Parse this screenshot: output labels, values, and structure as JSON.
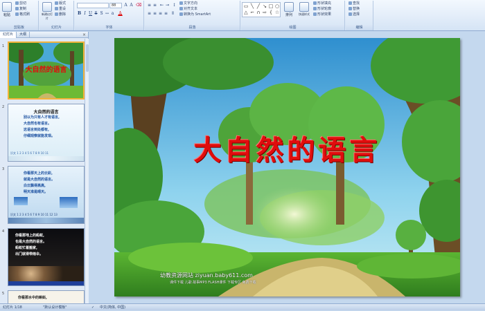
{
  "ribbon": {
    "clipboard": {
      "paste": "粘贴",
      "cut": "剪切",
      "copy": "复制",
      "format_painter": "格式刷",
      "label": "剪贴板"
    },
    "slides": {
      "new_slide": "新建幻灯片",
      "layout": "版式",
      "reset": "重设",
      "delete": "删除",
      "label": "幻灯片"
    },
    "font": {
      "font_name": "",
      "font_size": "88",
      "label": "字体"
    },
    "paragraph": {
      "text_direction": "文字方向",
      "align_text": "对齐文本",
      "convert_smartart": "转换为 SmartArt",
      "label": "段落"
    },
    "drawing": {
      "arrange": "排列",
      "quick_styles": "快速样式",
      "shape_fill": "形状填充",
      "shape_outline": "形状轮廓",
      "shape_effects": "形状效果",
      "label": "绘图"
    },
    "editing": {
      "find": "查找",
      "replace": "替换",
      "select": "选择",
      "label": "编辑"
    }
  },
  "panel": {
    "tab_slides": "幻灯片",
    "tab_outline": "大纲",
    "close": "×",
    "thumbs": [
      {
        "num": "1",
        "title": "大自然的语言"
      },
      {
        "num": "2",
        "title": "大自然的语言",
        "lines": [
          "别以为只有人才有语言,",
          "大自然也有语言。",
          "这语言到处都有,",
          "仔细观察就能发现。"
        ],
        "footer": "识文 1 2 3 4 5 6 7 8 9 10 11"
      },
      {
        "num": "3",
        "lines": [
          "你看那天上的云彩,",
          "就是大自然的语言。",
          "白云飘得高高,",
          "明天准是晴天。"
        ],
        "footer": "识文 1 2 3 4 5 6 7 8 9 10 11 12 13"
      },
      {
        "num": "4",
        "lines": [
          "你看那地上的蚂蚁,",
          "也是大自然的语言。",
          "蚂蚁忙着搬家,",
          "出门就得带雨伞。"
        ]
      },
      {
        "num": "5",
        "lines": [
          "你看那水中的蝌蚪,"
        ]
      }
    ]
  },
  "slide": {
    "title": "大自然的语言",
    "watermark": "幼教资源网站 ziyuan.baby611.com",
    "watermark_sub": "课件下载 儿歌 故事MP3 FLASH课件 下载专区 免费下载"
  },
  "status": {
    "slide_info": "幻灯片 1/18",
    "theme": "\"默认设计模板\"",
    "language": "中文(简体, 中国)"
  },
  "colors": {
    "title_red": "#e00d0d",
    "ribbon_bg": "#dbe7f6",
    "workspace": "#c4d8ee"
  }
}
